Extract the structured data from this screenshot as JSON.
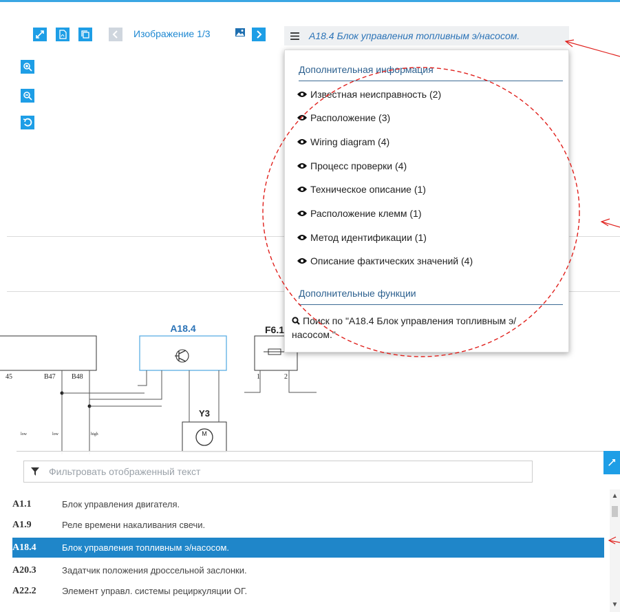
{
  "toolbar": {
    "image_label": "Изображение 1/3",
    "icons": [
      "expand-icon",
      "pdf-icon",
      "copy-icon",
      "prev-icon",
      "image-icon",
      "next-icon",
      "zoom-in-icon",
      "zoom-out-icon",
      "reset-icon"
    ]
  },
  "header": {
    "title": "A18.4 Блок управления топливным э/насосом."
  },
  "dropdown": {
    "section1": "Дополнительная информация",
    "items": [
      "Известная неисправность (2)",
      "Расположение (3)",
      "Wiring diagram (4)",
      "Процесс проверки (4)",
      "Техническое описание (1)",
      "Расположение клемм (1)",
      "Метод идентификации (1)",
      "Описание фактических значений (4)"
    ],
    "section2": "Дополнительные функции",
    "search_text": "Поиск по \"A18.4 Блок управления топливным э/насосом.\""
  },
  "diagram": {
    "a18_label": "A18.4",
    "f61_label": "F6.1",
    "y3_label": "Y3",
    "pins": [
      "45",
      "B47",
      "B48",
      "1",
      "2"
    ],
    "small": [
      "low",
      "low",
      "high"
    ]
  },
  "list": {
    "filter_placeholder": "Фильтровать отображенный текст",
    "rows": [
      {
        "code": "A1.1",
        "desc": "Блок управления двигателя."
      },
      {
        "code": "A1.9",
        "desc": "Реле времени накаливания свечи."
      },
      {
        "code": "A18.4",
        "desc": "Блок управления топливным э/насосом."
      },
      {
        "code": "A20.3",
        "desc": "Задатчик положения дроссельной заслонки."
      },
      {
        "code": "A22.2",
        "desc": "Элемент управл. системы рециркуляции ОГ."
      }
    ],
    "selected_index": 2
  },
  "colors": {
    "accent": "#1e9ee6",
    "selected_row": "#1f86c9",
    "annotation": "#e0201c"
  }
}
